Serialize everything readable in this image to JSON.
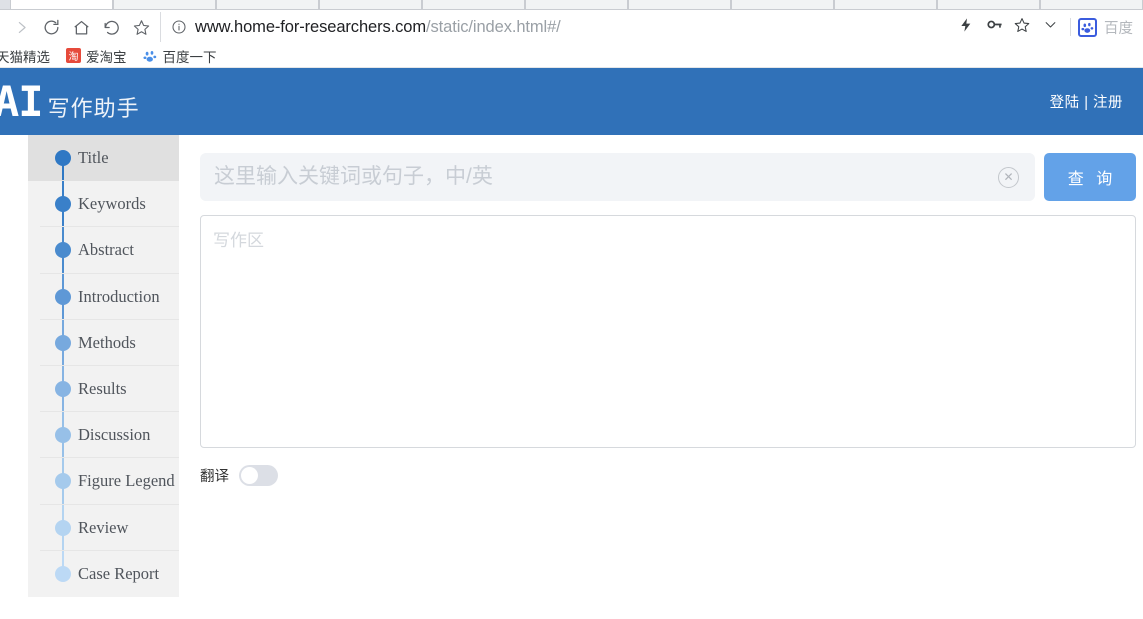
{
  "browser": {
    "tabs_count": 12,
    "active_tab_index": 0,
    "nav": {
      "forward_icon": "chevron-right-icon",
      "reload_icon": "reload-icon",
      "home_icon": "home-icon",
      "back_arc_icon": "undo-arrow-icon",
      "bookmark_icon": "star-icon"
    },
    "omnibox": {
      "site_info_icon": "info-circle-icon",
      "url_domain": "www.home-for-researchers.com",
      "url_path": "/static/index.html#/"
    },
    "toolbar_right": {
      "flash_icon": "lightning-icon",
      "password_icon": "key-icon",
      "bookmark_star_icon": "star-outline-icon",
      "chevron_icon": "chevron-down-icon",
      "extension_icon": "baidu-paw-icon",
      "extension_label": "百度"
    },
    "bookmarks": [
      {
        "label": "天猫精选",
        "icon": "tmall-icon",
        "clipped": true
      },
      {
        "label": "爱淘宝",
        "icon": "taobao-icon",
        "favicon_text": "淘"
      },
      {
        "label": "百度一下",
        "icon": "baidu-paw-icon"
      }
    ]
  },
  "site": {
    "header": {
      "brand_mark": "AI",
      "brand_subtitle": "写作助手",
      "auth_links": "登陆 | 注册",
      "background_color": "#3071b8"
    },
    "sidebar": {
      "items": [
        {
          "label": "Title",
          "dot_color": "#2f78c4",
          "rail_color": "#2f78c4",
          "active": true
        },
        {
          "label": "Keywords",
          "dot_color": "#3a80c9",
          "rail_color": "#3a80c9",
          "active": false
        },
        {
          "label": "Abstract",
          "dot_color": "#4a8bce",
          "rail_color": "#4a8bce",
          "active": false
        },
        {
          "label": "Introduction",
          "dot_color": "#5e98d6",
          "rail_color": "#5e98d6",
          "active": false
        },
        {
          "label": "Methods",
          "dot_color": "#77a9de",
          "rail_color": "#77a9de",
          "active": false
        },
        {
          "label": "Results",
          "dot_color": "#87b4e3",
          "rail_color": "#87b4e3",
          "active": false
        },
        {
          "label": "Discussion",
          "dot_color": "#97c0e8",
          "rail_color": "#97c0e8",
          "active": false
        },
        {
          "label": "Figure Legend",
          "dot_color": "#a5caec",
          "rail_color": "#a5caec",
          "active": false
        },
        {
          "label": "Review",
          "dot_color": "#b4d4f1",
          "rail_color": "#b4d4f1",
          "active": false
        },
        {
          "label": "Case Report",
          "dot_color": "#bcd9f5",
          "rail_color": "#bcd9f5",
          "active": false
        }
      ]
    },
    "search": {
      "placeholder": "这里输入关键词或句子，中/英",
      "value": "",
      "clear_icon": "close-circle-icon",
      "button_label": "查 询",
      "button_color": "#63a2e8"
    },
    "editor": {
      "placeholder": "写作区",
      "value": ""
    },
    "translate": {
      "label": "翻译",
      "enabled": false
    }
  }
}
